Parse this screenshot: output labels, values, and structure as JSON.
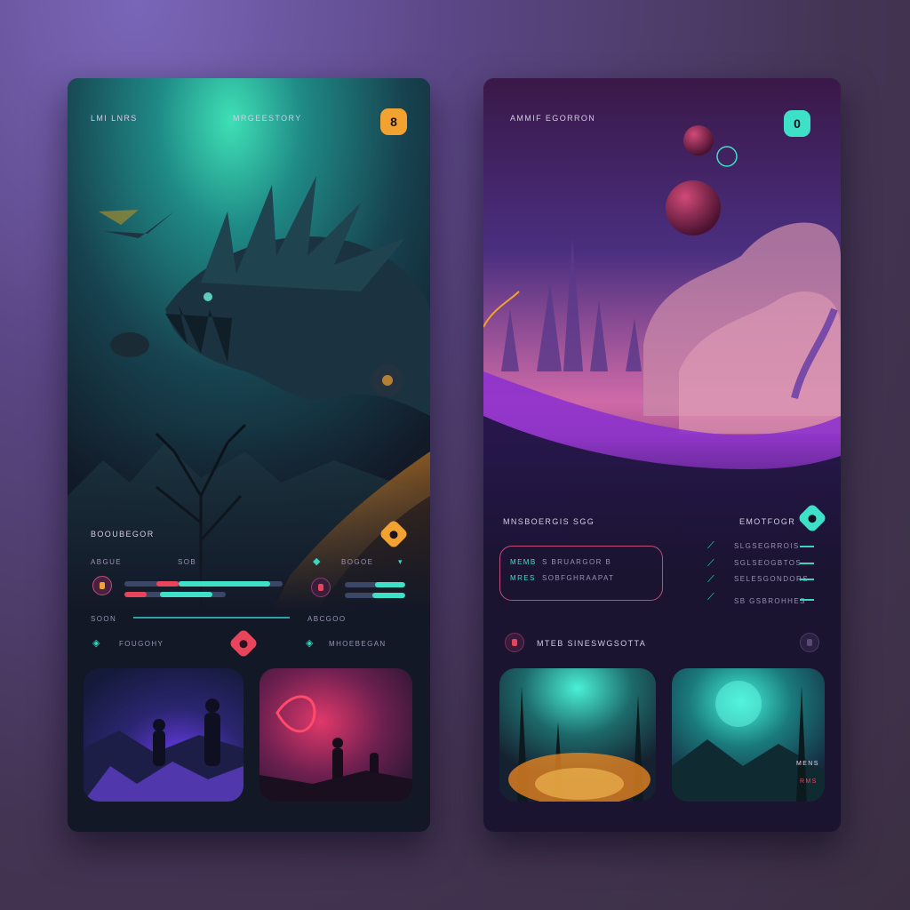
{
  "left_card": {
    "header_left": "LMI LNRS",
    "header_center": "MRGEESTORY",
    "header_badge": "8",
    "section_label": "BOOUBEGOR",
    "stats": {
      "label_a": "ABGUE",
      "label_b": "SOB",
      "label_c": "BOGOE",
      "bar_1": {
        "cyan": 0.58,
        "red": 0.14
      },
      "bar_2": {
        "cyan": 0.52,
        "red": 0.22
      },
      "bar_3": {
        "cyan": 0.5
      },
      "bar_4": {
        "cyan": 0.55
      }
    },
    "row_label_a": "SOON",
    "row_label_b": "ABCGOO",
    "item_a": "FOUGOHY",
    "item_b": "MHOEBEGAN"
  },
  "right_card": {
    "header_left": "AMMIF EGORRON",
    "header_badge": "0",
    "section_title": "MNSBOERGIS  SGG",
    "section_right": "EMOTFOGR",
    "panel_rows": [
      {
        "key": "MEMB",
        "value": "S  BRUARGOR  B"
      },
      {
        "key": "MRES",
        "value": "SOBFGHRAAPAT"
      }
    ],
    "list_items": [
      "SLGSEGRROIS",
      "SGLSEOGBTOS",
      "SELESGONDORS",
      "SB GSBROHHES"
    ],
    "footer_label": "MTEB SINESWGSOTTA",
    "thumb_caption_a": "MENS",
    "thumb_caption_b": "RMS"
  },
  "colors": {
    "accent_cyan": "#3ee0c8",
    "accent_red": "#e8445c",
    "accent_orange": "#f2a230",
    "accent_magenta": "#c24d7a"
  }
}
